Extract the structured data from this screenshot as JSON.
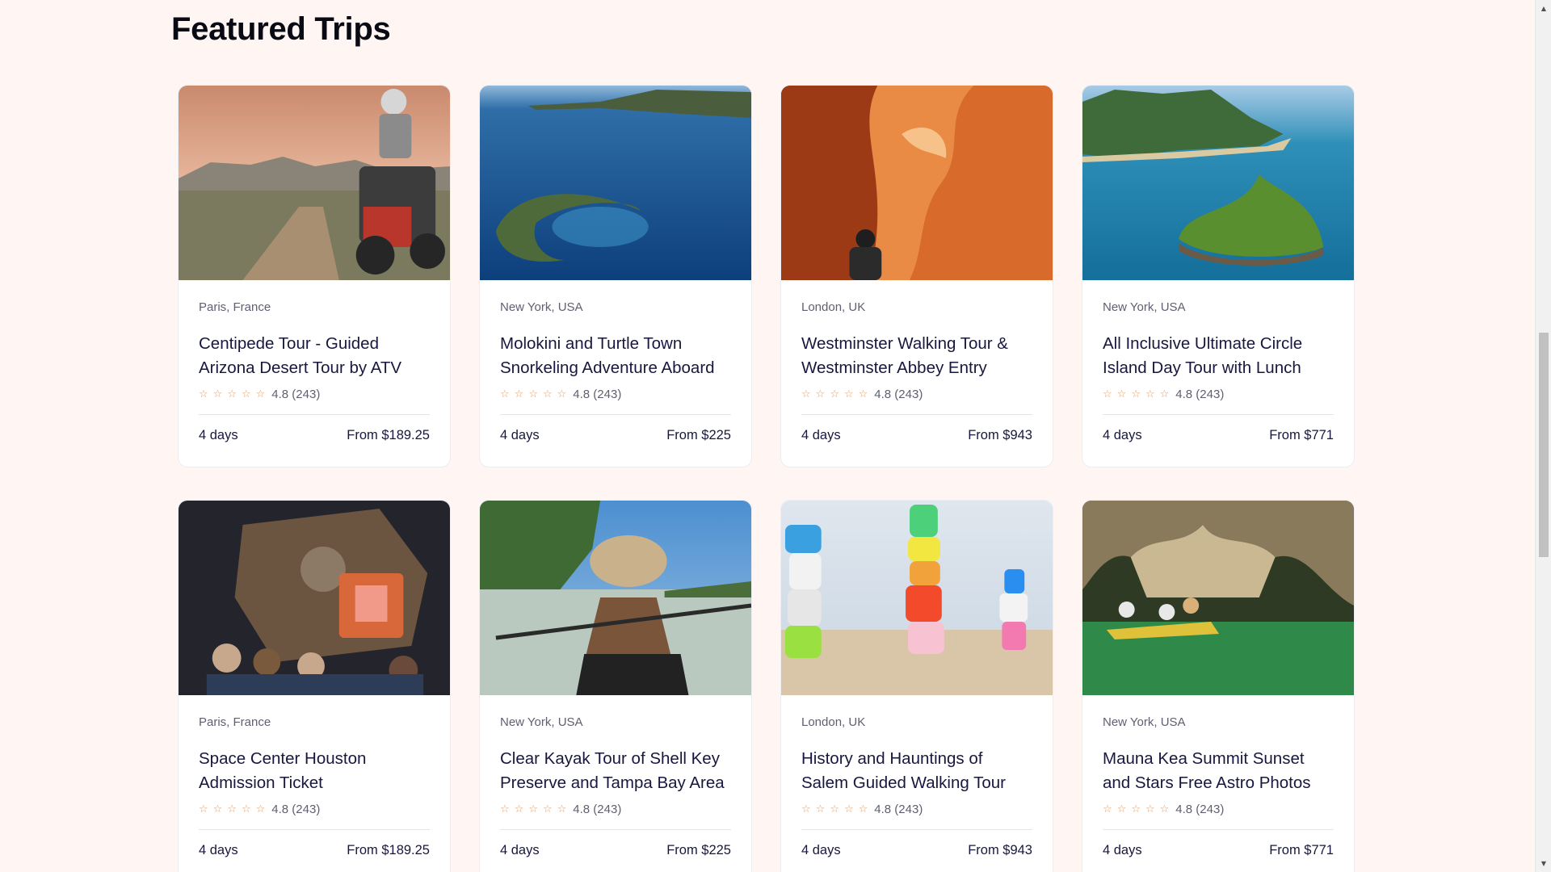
{
  "section": {
    "title": "Featured Trips"
  },
  "star_glyph": "☆",
  "cards": [
    {
      "location": "Paris, France",
      "title": "Centipede Tour - Guided Arizona Desert Tour by ATV",
      "rating": "4.8 (243)",
      "duration": "4 days",
      "price": "From $189.25",
      "image": "atv-desert"
    },
    {
      "location": "New York, USA",
      "title": "Molokini and Turtle Town Snorkeling Adventure Aboard",
      "rating": "4.8 (243)",
      "duration": "4 days",
      "price": "From $225",
      "image": "crater-island"
    },
    {
      "location": "London, UK",
      "title": "Westminster Walking Tour & Westminster Abbey Entry",
      "rating": "4.8 (243)",
      "duration": "4 days",
      "price": "From $943",
      "image": "slot-canyon"
    },
    {
      "location": "New York, USA",
      "title": "All Inclusive Ultimate Circle Island Day Tour with Lunch",
      "rating": "4.8 (243)",
      "duration": "4 days",
      "price": "From $771",
      "image": "tropical-island"
    },
    {
      "location": "Paris, France",
      "title": "Space Center Houston Admission Ticket",
      "rating": "4.8 (243)",
      "duration": "4 days",
      "price": "From $189.25",
      "image": "space-capsule"
    },
    {
      "location": "New York, USA",
      "title": "Clear Kayak Tour of Shell Key Preserve and Tampa Bay Area",
      "rating": "4.8 (243)",
      "duration": "4 days",
      "price": "From $225",
      "image": "kayak"
    },
    {
      "location": "London, UK",
      "title": "History and Hauntings of Salem Guided Walking Tour",
      "rating": "4.8 (243)",
      "duration": "4 days",
      "price": "From $943",
      "image": "rock-towers"
    },
    {
      "location": "New York, USA",
      "title": "Mauna Kea Summit Sunset and Stars Free Astro Photos",
      "rating": "4.8 (243)",
      "duration": "4 days",
      "price": "From $771",
      "image": "sea-cave-canoe"
    }
  ],
  "colors": {
    "background": "#fff6f3",
    "title": "#17173f",
    "star": "#e0a06b",
    "muted": "#5f5f72"
  }
}
